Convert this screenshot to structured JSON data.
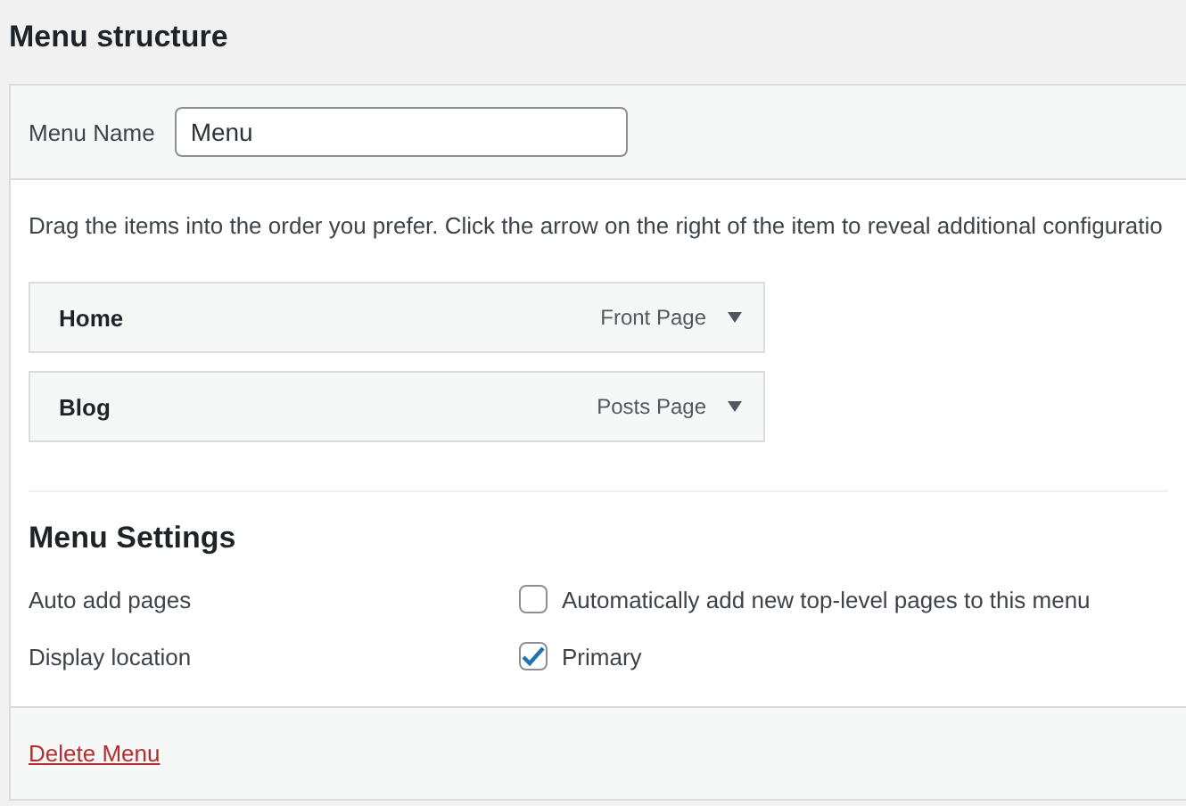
{
  "title": "Menu structure",
  "menu_name": {
    "label": "Menu Name",
    "value": "Menu"
  },
  "instructions": "Drag the items into the order you prefer. Click the arrow on the right of the item to reveal additional configuratio",
  "menu_items": [
    {
      "title": "Home",
      "type": "Front Page"
    },
    {
      "title": "Blog",
      "type": "Posts Page"
    }
  ],
  "settings": {
    "heading": "Menu Settings",
    "rows": [
      {
        "label": "Auto add pages",
        "option": "Automatically add new top-level pages to this menu",
        "checked": false
      },
      {
        "label": "Display location",
        "option": "Primary",
        "checked": true
      }
    ]
  },
  "delete_link": "Delete Menu"
}
